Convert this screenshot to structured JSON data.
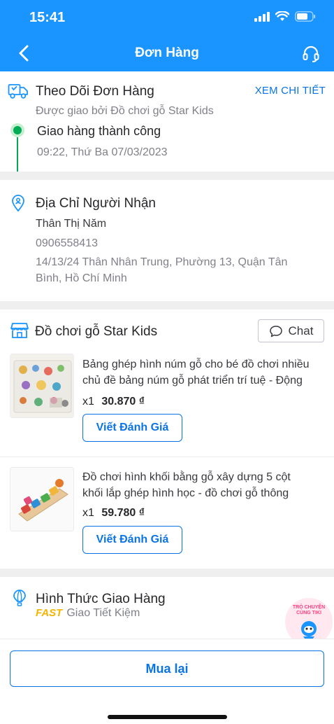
{
  "status_bar": {
    "time": "15:41"
  },
  "header": {
    "title": "Đơn Hàng"
  },
  "tracking": {
    "title": "Theo Dõi Đơn Hàng",
    "link": "XEM CHI TIẾT",
    "carrier": "Được giao bởi Đồ chơi gỗ Star Kids",
    "status": "Giao hàng thành công",
    "timestamp": "09:22, Thứ Ba 07/03/2023"
  },
  "recipient": {
    "title": "Địa Chỉ Người Nhận",
    "name": "Thân Thị Năm",
    "phone": "0906558413",
    "address_line1": "14/13/24 Thân Nhân Trung, Phường 13, Quận Tân",
    "address_line2": "Bình, Hồ Chí Minh"
  },
  "shop": {
    "name": "Đồ chơi gỗ Star Kids",
    "chat_label": "Chat"
  },
  "products": [
    {
      "name_line1": "Bảng ghép hình núm gỗ cho bé đồ chơi nhiều",
      "name_line2": "chủ đề bảng núm gỗ phát triển trí tuệ - Động",
      "qty": "x1",
      "price": "30.870 ₫",
      "review_label": "Viết Đánh Giá"
    },
    {
      "name_line1": "Đồ chơi hình khối bằng gỗ xây dựng 5 cột",
      "name_line2": "khối lắp ghép hình học - đồ chơi gỗ thông",
      "qty": "x1",
      "price": "59.780 ₫",
      "review_label": "Viết Đánh Giá"
    }
  ],
  "shipping": {
    "title": "Hình Thức Giao Hàng",
    "badge": "FAST",
    "method": "Giao Tiết Kiệm"
  },
  "chat_bot": {
    "label_line1": "TRÒ CHUYỆN",
    "label_line2": "CÙNG TIKI"
  },
  "actions": {
    "buy_again": "Mua lại"
  },
  "colors": {
    "primary": "#1a94ff",
    "link": "#0b74e5",
    "success": "#00ab56",
    "fast": "#f5b400"
  }
}
